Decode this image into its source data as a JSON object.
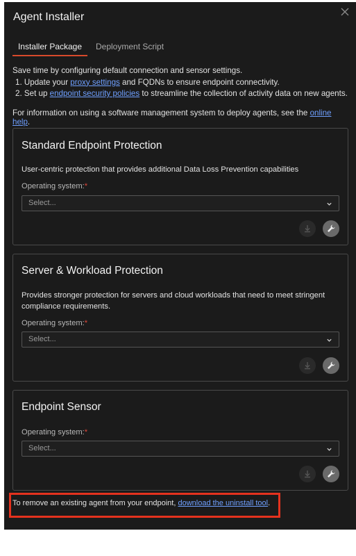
{
  "dialog": {
    "title": "Agent Installer"
  },
  "tabs": [
    {
      "label": "Installer Package",
      "active": true
    },
    {
      "label": "Deployment Script",
      "active": false
    }
  ],
  "intro": {
    "line1": "Save time by configuring default connection and sensor settings.",
    "step1_prefix": "1. Update your ",
    "step1_link": "proxy settings",
    "step1_suffix": " and FQDNs to ensure endpoint connectivity.",
    "step2_prefix": "2. Set up ",
    "step2_link": "endpoint security policies",
    "step2_suffix": " to streamline the collection of activity data on new agents."
  },
  "help": {
    "prefix": "For information on using a software management system to deploy agents, see the ",
    "link": "online help",
    "suffix": "."
  },
  "cards": [
    {
      "title": "Standard Endpoint Protection",
      "description": "User-centric protection that provides additional Data Loss Prevention capabilities",
      "os_label": "Operating system:",
      "required_mark": "*",
      "select_placeholder": "Select..."
    },
    {
      "title": "Server & Workload Protection",
      "description": "Provides stronger protection for servers and cloud workloads that need to meet stringent compliance requirements.",
      "os_label": "Operating system:",
      "required_mark": "*",
      "select_placeholder": "Select..."
    },
    {
      "title": "Endpoint Sensor",
      "description": "",
      "os_label": "Operating system:",
      "required_mark": "*",
      "select_placeholder": "Select..."
    }
  ],
  "footer": {
    "prefix": "To remove an existing agent from your endpoint, ",
    "link": "download the uninstall tool",
    "suffix": "."
  },
  "icons": {
    "close": "close-icon",
    "chevron": "chevron-down-icon",
    "download": "download-icon",
    "settings": "wrench-icon"
  },
  "colors": {
    "background": "#1b1b1b",
    "active_tab_underline": "#d94a2b",
    "link": "#6fa0ff",
    "required": "#e0483a",
    "highlight_box": "#e4321e"
  }
}
